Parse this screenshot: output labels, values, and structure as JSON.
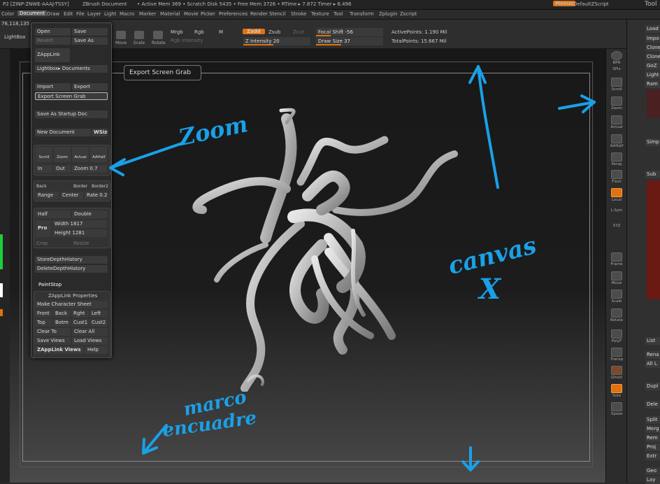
{
  "titlebar": {
    "project": "P2 [ZINP-ZNWE-AAAJ-TSSY]",
    "doc": "ZBrush Document",
    "stats": "• Active Mem 369 • Scratch Disk 5435 • Free Mem 3726 • RTime ▸ 7.872 Timer ▸ 6.496",
    "menus": "Menus",
    "script": "DefaultZScript",
    "tool": "Tool"
  },
  "menubar": [
    "Color",
    "Document",
    "Draw",
    "Edit",
    "File",
    "Layer",
    "Light",
    "Macro",
    "Marker",
    "Material",
    "Movie",
    "Picker",
    "Preferences",
    "Render",
    "Stencil",
    "Stroke",
    "Texture",
    "Tool",
    "Transform",
    "Zplugin",
    "Zscript"
  ],
  "shelf": {
    "coords": "76,118,135",
    "lightbox": "LightBox",
    "move": "Move",
    "scale": "Scale",
    "rotate": "Rotate",
    "mrgb": "Mrgb",
    "rgb": "Rgb",
    "m": "M",
    "rgb_intensity": "Rgb Intensity",
    "zadd": "Zadd",
    "zsub": "Zsub",
    "zcut": "Zcut",
    "z_intensity": "Z Intensity 20",
    "focal_shift": "Focal Shift -56",
    "draw_size": "Draw Size 37",
    "active_points": "ActivePoints: 1.190 Mil",
    "total_points": "TotalPoints: 15.667 Mil"
  },
  "docpanel": {
    "open": "Open",
    "save": "Save",
    "revert": "Revert",
    "save_as": "Save As",
    "zapplink": "ZAppLink",
    "lightbox_docs": "Lightbox▸ Documents",
    "import": "Import",
    "export": "Export",
    "export_screen_grab": "Export Screen Grab",
    "save_startup": "Save As Startup Doc",
    "new_document": "New Document",
    "wsize": "WSize",
    "scroll": "Scroll",
    "zoom": "Zoom",
    "actual": "Actual",
    "aahalf": "AAHalf",
    "in": "In",
    "out": "Out",
    "zoom_value": "Zoom 0.7",
    "back": "Back",
    "border": "Border",
    "border2": "Border2",
    "range": "Range",
    "center": "Center",
    "rate": "Rate 0.2",
    "half": "Half",
    "double": "Double",
    "pro": "Pro",
    "width": "Width 1817",
    "height": "Height 1281",
    "crop": "Crop",
    "resize": "Resize",
    "store_depth": "StoreDepthHistory",
    "delete_depth": "DeleteDepthHistory",
    "paintstop": "PaintStop",
    "zapplink_props": "ZAppLink Properties",
    "make_char_sheet": "Make Character Sheet",
    "front": "Front",
    "back2": "Back",
    "rght": "Rght",
    "left": "Left",
    "top": "Top",
    "botm": "Botm",
    "cust1": "Cust1",
    "cust2": "Cust2",
    "clear_to": "Clear To",
    "clear_all": "Clear All",
    "save_views": "Save Views",
    "load_views": "Load Views",
    "zapplink_views": "ZAppLink Views",
    "help": "Help"
  },
  "tooltip": "Export Screen Grab",
  "rightshelf": [
    "BPR",
    "SPix",
    "Scroll",
    "Zoom",
    "Actual",
    "AAHalf",
    "Persp",
    "Floor",
    "Local",
    "L.Sym",
    "XYZ",
    "Frame",
    "Move",
    "Scale",
    "Rotate",
    "PolyF",
    "Transp",
    "Ghost",
    "Solo",
    "Xpose"
  ],
  "rightpanel": [
    "Load",
    "Impo",
    "Clone",
    "Clone",
    "GoZ",
    "Light",
    "Ram",
    "Simp",
    "Sub",
    "List",
    "Rena",
    "All L",
    "Dupl",
    "Dele",
    "Split",
    "Merg",
    "Rem",
    "Proj",
    "Extr",
    "Geo",
    "Lay"
  ],
  "annotations": {
    "zoom": "Zoom",
    "canvas": "canvas",
    "marco": "marco",
    "encuadre": "encuadre"
  },
  "colors": {
    "accent": "#e0720f",
    "annotation": "#1aa0e8"
  }
}
